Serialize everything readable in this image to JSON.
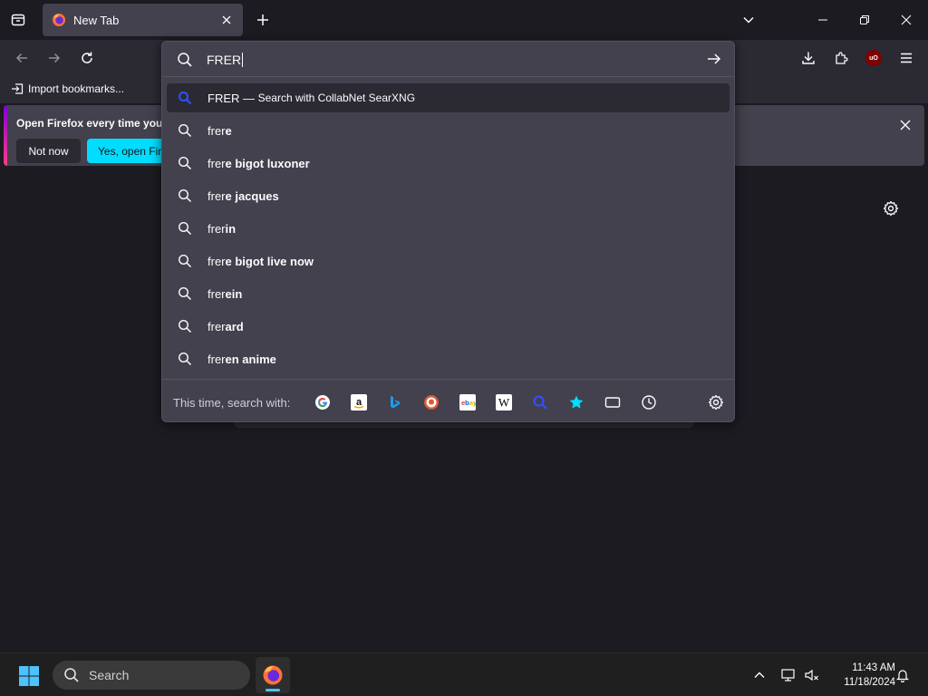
{
  "tab": {
    "title": "New Tab"
  },
  "bookmarks": {
    "import_label": "Import bookmarks..."
  },
  "notification": {
    "message": "Open Firefox every time you",
    "not_now": "Not now",
    "yes_open": "Yes, open Fire"
  },
  "urlbar": {
    "value": "FRER",
    "results": [
      {
        "typed": "FRER",
        "separator": " — ",
        "action": "Search with CollabNet SearXNG",
        "selected": true
      },
      {
        "typed": "frer",
        "completion": "e"
      },
      {
        "typed": "frer",
        "completion": "e bigot luxoner"
      },
      {
        "typed": "frer",
        "completion": "e jacques"
      },
      {
        "typed": "frer",
        "completion": "in"
      },
      {
        "typed": "frer",
        "completion": "e bigot live now"
      },
      {
        "typed": "frer",
        "completion": "ein"
      },
      {
        "typed": "frer",
        "completion": "ard"
      },
      {
        "typed": "frer",
        "completion": "en anime"
      }
    ],
    "oneoff_label": "This time, search with:",
    "oneoff_engines": [
      "Google",
      "Amazon",
      "Bing",
      "DuckDuckGo",
      "eBay",
      "Wikipedia",
      "SearXNG",
      "Bookmarks",
      "Tabs",
      "History"
    ]
  },
  "taskbar": {
    "search_label": "Search",
    "time": "11:43 AM",
    "date": "11/18/2024"
  },
  "colors": {
    "accent_cyan": "#00ddff",
    "popup_bg": "#42414d",
    "toolbar_bg": "#2b2a33",
    "content_bg": "#1c1b22",
    "ublock_red": "#800000"
  }
}
